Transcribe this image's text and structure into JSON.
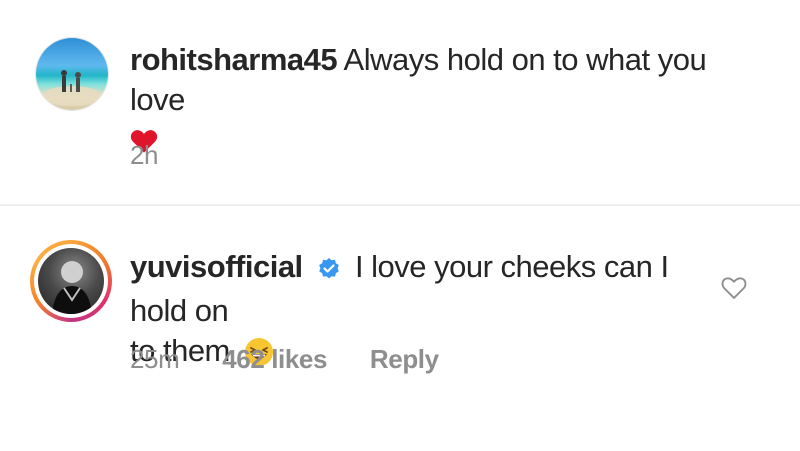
{
  "comments": [
    {
      "username": "rohitsharma45",
      "text": "Always hold on to what you love",
      "emoji": "red-heart-emoji",
      "time": "2h"
    },
    {
      "username": "yuvisofficial",
      "verified": true,
      "text_line1": "I love your cheeks can I hold on",
      "text_line2": "to them",
      "emoji": "grinning-squinting-face-emoji",
      "time": "25m",
      "likes": "462 likes",
      "reply_label": "Reply",
      "like_icon": "heart-outline-icon"
    }
  ],
  "colors": {
    "text": "#262626",
    "meta": "#8e8e8e",
    "verified": "#3897f0",
    "heart": "#e0152b"
  }
}
